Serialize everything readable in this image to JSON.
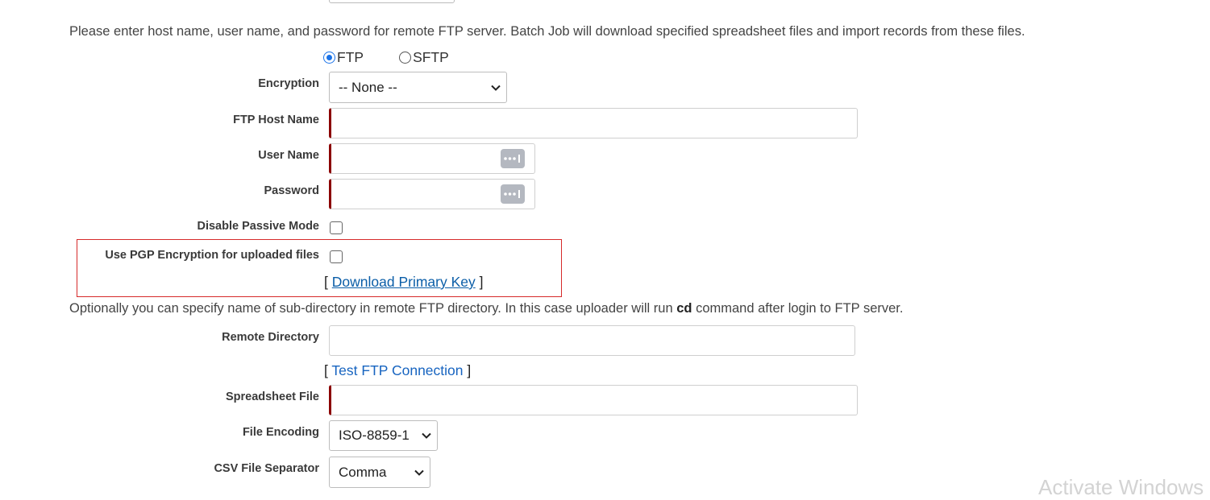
{
  "form": {
    "intro_text": "Please enter host name, user name, and password for remote FTP server. Batch Job will download specified spreadsheet files and import records from these files.",
    "protocol": {
      "options": [
        {
          "label": "FTP",
          "selected": true
        },
        {
          "label": "SFTP",
          "selected": false
        }
      ]
    },
    "encryption": {
      "label": "Encryption",
      "value": "-- None --"
    },
    "ftp_host": {
      "label": "FTP Host Name",
      "value": ""
    },
    "user_name": {
      "label": "User Name",
      "value": ""
    },
    "password": {
      "label": "Password",
      "value": ""
    },
    "disable_passive": {
      "label": "Disable Passive Mode",
      "checked": false
    },
    "pgp": {
      "label": "Use PGP Encryption for uploaded files",
      "checked": false,
      "link_label": "Download Primary Key",
      "bracket_open": "[",
      "bracket_close": "]"
    },
    "subdir_text_before": "Optionally you can specify name of sub-directory in remote FTP directory. In this case uploader will run ",
    "subdir_text_cmd": "cd",
    "subdir_text_after": " command after login to FTP server.",
    "remote_dir": {
      "label": "Remote Directory",
      "value": ""
    },
    "test_connection": {
      "link_label": "Test FTP Connection",
      "bracket_open": "[",
      "bracket_close": "]"
    },
    "spreadsheet_file": {
      "label": "Spreadsheet File",
      "value": ""
    },
    "file_encoding": {
      "label": "File Encoding",
      "value": "ISO-8859-1"
    },
    "csv_separator": {
      "label": "CSV File Separator",
      "value": "Comma"
    }
  },
  "watermark": "Activate Windows",
  "colors": {
    "required_marker": "#8b0000",
    "highlight_border": "#d62a2a",
    "link": "#0b5ea8",
    "radio_selected": "#1a73e8"
  },
  "icons": {
    "password_manager": "keypass-icon",
    "dropdown": "chevron-down-icon"
  }
}
